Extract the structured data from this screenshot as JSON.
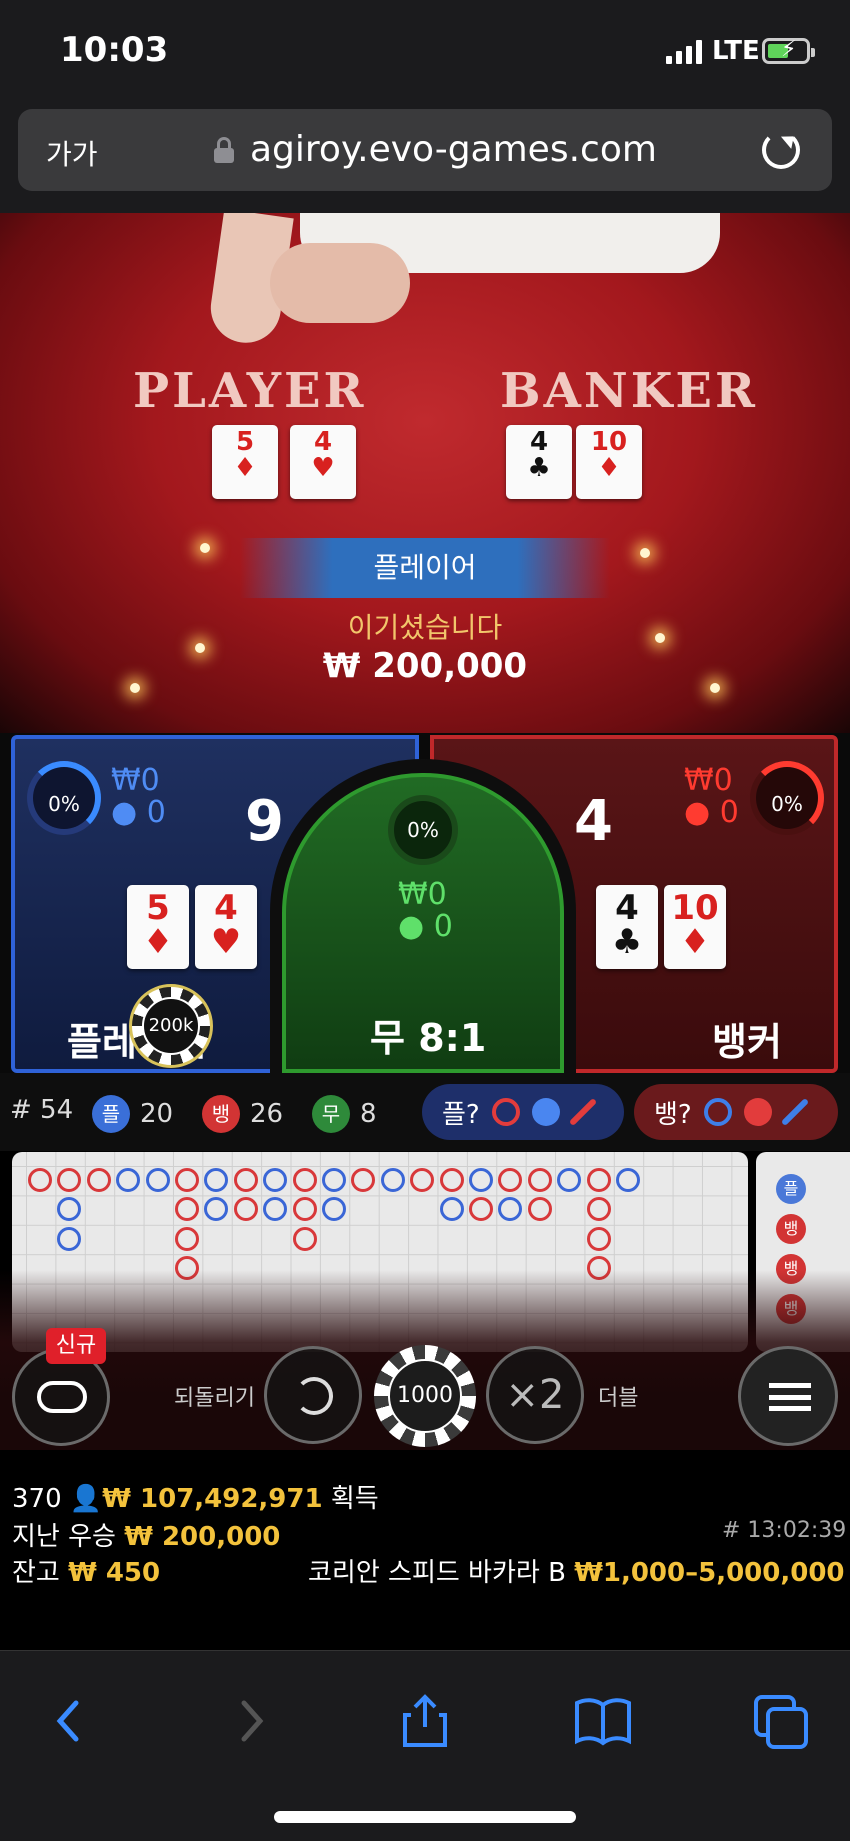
{
  "status": {
    "time": "10:03",
    "network": "LTE"
  },
  "browser": {
    "text_size": "가가",
    "url": "agiroy.evo-games.com"
  },
  "table": {
    "player_label": "PLAYER",
    "banker_label": "BANKER",
    "player_cards": [
      {
        "rank": "5",
        "suit": "♦",
        "color": "red"
      },
      {
        "rank": "4",
        "suit": "♥",
        "color": "red"
      }
    ],
    "banker_cards": [
      {
        "rank": "4",
        "suit": "♣",
        "color": "black"
      },
      {
        "rank": "10",
        "suit": "♦",
        "color": "red"
      }
    ],
    "winner": "플레이어",
    "win_text": "이기셨습니다",
    "win_amount": "₩ 200,000"
  },
  "bets": {
    "player": {
      "percent": "0%",
      "amount": "₩0",
      "users": "0",
      "score": "9",
      "label": "플레이어",
      "chip": "200k",
      "cards": [
        {
          "rank": "5",
          "suit": "♦"
        },
        {
          "rank": "4",
          "suit": "♥"
        }
      ]
    },
    "tie": {
      "percent": "0%",
      "amount": "₩0",
      "users": "0",
      "label": "무 8:1"
    },
    "banker": {
      "percent": "0%",
      "amount": "₩0",
      "users": "0",
      "score": "4",
      "label": "뱅커",
      "cards": [
        {
          "rank": "4",
          "suit": "♣",
          "color": "black"
        },
        {
          "rank": "10",
          "suit": "♦",
          "color": "red"
        }
      ]
    }
  },
  "stats": {
    "round": "# 54",
    "player_label": "플",
    "player_count": "20",
    "banker_label": "뱅",
    "banker_count": "26",
    "tie_label": "무",
    "tie_count": "8",
    "player_predict": "플?",
    "banker_predict": "뱅?"
  },
  "roadmap_side": [
    "플",
    "뱅",
    "뱅",
    "뱅"
  ],
  "controls": {
    "new_badge": "신규",
    "undo_label": "되돌리기",
    "chip_value": "1000",
    "double_symbol": "×2",
    "double_label": "더블"
  },
  "info": {
    "players": "370",
    "total_win": "₩ 107,492,971",
    "win_word": "획득",
    "last_win_label": "지난 우승",
    "last_win": "₩ 200,000",
    "game_id": "# 13:02:39",
    "balance_label": "잔고",
    "balance": "₩ 450",
    "table_name": "코리안 스피드 바카라 B",
    "limits": "₩1,000–5,000,000"
  }
}
